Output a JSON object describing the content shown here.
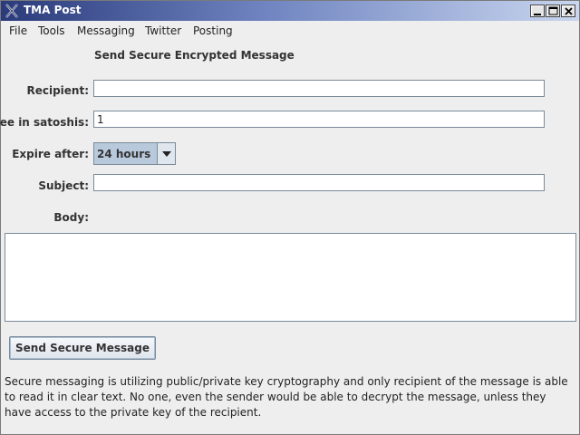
{
  "window": {
    "title": "TMA Post"
  },
  "menu": {
    "items": [
      "File",
      "Tools",
      "Messaging",
      "Twitter",
      "Posting"
    ]
  },
  "form": {
    "heading": "Send Secure Encrypted Message",
    "recipient_label": "Recipient:",
    "recipient_value": "",
    "fee_label": "Fee in satoshis:",
    "fee_value": "1",
    "expire_label": "Expire after:",
    "expire_value": "24 hours",
    "subject_label": "Subject:",
    "subject_value": "",
    "body_label": "Body:",
    "body_value": "",
    "send_button": "Send Secure Message",
    "info_text": "Secure messaging is utilizing public/private key cryptography and only recipient of the message is able to read it in clear text. No one, even the sender would be able to decrypt the message, unless they have access to the private key of the recipient."
  },
  "icons": {
    "app": "x-logo-icon",
    "minimize": "minimize-icon",
    "maximize": "maximize-icon",
    "close": "close-icon",
    "dropdown": "chevron-down-icon"
  },
  "colors": {
    "titlebar_dark": "#2a3a7a",
    "titlebar_light": "#c9d6ef",
    "background": "#eeeeee",
    "combo_bg": "#b8c9dc"
  }
}
